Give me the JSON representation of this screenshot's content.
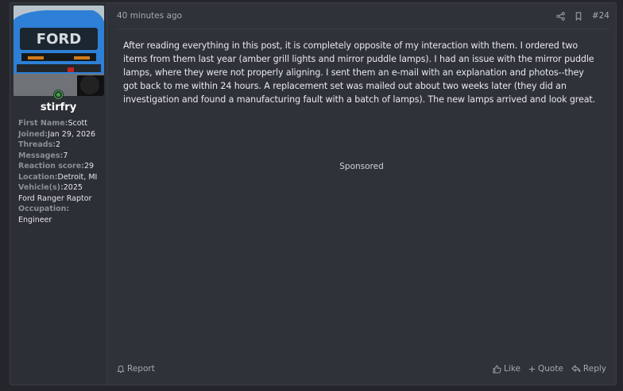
{
  "post": {
    "timestamp": "40 minutes ago",
    "number": "#24",
    "body": "After reading everything in this post, it is completely opposite of my interaction with them. I ordered two items from them last year (amber grill lights and mirror puddle lamps). I had an issue with the mirror puddle lamps, where they were not properly aligning. I sent them an e-mail with an explanation and photos--they got back to me within 24 hours. A replacement set was mailed out about two weeks later (they did an investigation and found a manufacturing fault with a batch of lamps). The new lamps arrived and look great.",
    "sponsored_label": "Sponsored"
  },
  "user": {
    "username": "stirfry",
    "stats": [
      {
        "label": "First Name:",
        "value": "Scott"
      },
      {
        "label": "Joined:",
        "value": "Jan 29, 2026"
      },
      {
        "label": "Threads:",
        "value": "2"
      },
      {
        "label": "Messages:",
        "value": "7"
      },
      {
        "label": "Reaction score:",
        "value": "29"
      },
      {
        "label": "Location:",
        "value": "Detroit, MI"
      },
      {
        "label": "Vehicle(s):",
        "value": "2025"
      },
      {
        "label": "",
        "value": "Ford Ranger Raptor"
      },
      {
        "label": "Occupation:",
        "value": ""
      },
      {
        "label": "",
        "value": "Engineer"
      }
    ]
  },
  "actions": {
    "report": "Report",
    "like": "Like",
    "quote": "Quote",
    "reply": "Reply"
  },
  "colors": {
    "online": "#3fa83f",
    "truck_blue": "#2e7fd6"
  }
}
